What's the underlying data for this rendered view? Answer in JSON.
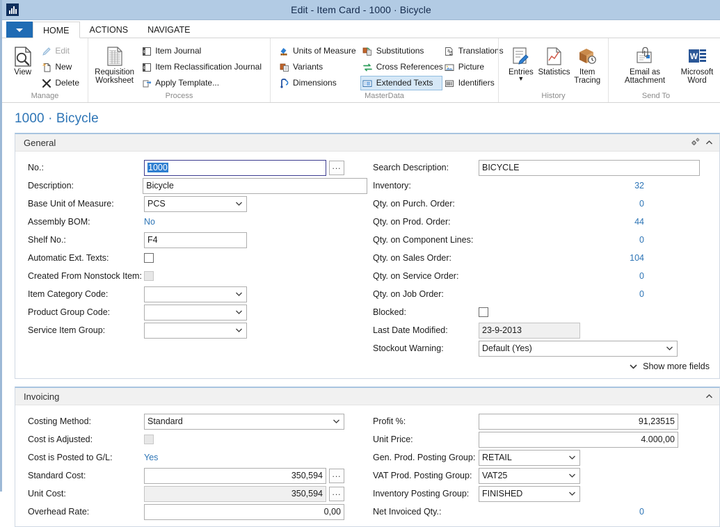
{
  "window": {
    "title": "Edit - Item Card - 1000 · Bicycle",
    "app_icon": "nav-app-icon"
  },
  "ribbon": {
    "app_menu": "application-menu",
    "tabs": [
      {
        "label": "HOME",
        "active": true
      },
      {
        "label": "ACTIONS",
        "active": false
      },
      {
        "label": "NAVIGATE",
        "active": false
      }
    ],
    "groups": [
      {
        "name": "Manage",
        "big": [
          {
            "label": "View",
            "icon": "view-page-icon"
          }
        ],
        "small": [
          {
            "label": "Edit",
            "icon": "pencil-icon",
            "state": "disabled"
          },
          {
            "label": "New",
            "icon": "new-page-icon",
            "state": "normal"
          },
          {
            "label": "Delete",
            "icon": "delete-x-icon",
            "state": "normal"
          }
        ]
      },
      {
        "name": "Process",
        "big": [
          {
            "label": "Requisition Worksheet",
            "icon": "worksheet-icon"
          }
        ],
        "small": [
          {
            "label": "Item Journal",
            "icon": "journal-icon",
            "state": "normal"
          },
          {
            "label": "Item Reclassification Journal",
            "icon": "journal-icon",
            "state": "normal"
          },
          {
            "label": "Apply Template...",
            "icon": "apply-template-icon",
            "state": "normal"
          }
        ]
      },
      {
        "name": "MasterData",
        "columns": [
          [
            {
              "label": "Units of Measure",
              "icon": "units-of-measure-icon",
              "state": "normal"
            },
            {
              "label": "Variants",
              "icon": "variants-icon",
              "state": "normal"
            },
            {
              "label": "Dimensions",
              "icon": "dimensions-icon",
              "state": "normal"
            }
          ],
          [
            {
              "label": "Substitutions",
              "icon": "substitutions-icon",
              "state": "normal"
            },
            {
              "label": "Cross References",
              "icon": "cross-references-icon",
              "state": "normal"
            },
            {
              "label": "Extended Texts",
              "icon": "extended-texts-icon",
              "state": "selected"
            }
          ],
          [
            {
              "label": "Translations",
              "icon": "translations-icon",
              "state": "normal"
            },
            {
              "label": "Picture",
              "icon": "picture-icon",
              "state": "normal"
            },
            {
              "label": "Identifiers",
              "icon": "identifiers-icon",
              "state": "normal"
            }
          ]
        ]
      },
      {
        "name": "History",
        "big": [
          {
            "label": "Entries",
            "icon": "entries-icon",
            "dropdown": true
          },
          {
            "label": "Statistics",
            "icon": "statistics-icon"
          },
          {
            "label": "Item Tracing",
            "icon": "item-tracing-icon"
          }
        ]
      },
      {
        "name": "Send To",
        "big": [
          {
            "label": "Email as Attachment",
            "icon": "email-attachment-icon"
          },
          {
            "label": "Microsoft Word",
            "icon": "microsoft-word-icon"
          }
        ]
      }
    ]
  },
  "page": {
    "heading_no": "1000",
    "heading_sep": "·",
    "heading_name": "Bicycle"
  },
  "general": {
    "title": "General",
    "left": {
      "no_label": "No.:",
      "no_value": "1000",
      "description_label": "Description:",
      "description_value": "Bicycle",
      "base_uom_label": "Base Unit of Measure:",
      "base_uom_value": "PCS",
      "assembly_bom_label": "Assembly BOM:",
      "assembly_bom_value": "No",
      "shelf_no_label": "Shelf No.:",
      "shelf_no_value": "F4",
      "auto_ext_texts_label": "Automatic Ext. Texts:",
      "auto_ext_texts_checked": false,
      "created_nonstock_label": "Created From Nonstock Item:",
      "created_nonstock_checked": false,
      "item_category_label": "Item Category Code:",
      "item_category_value": "",
      "product_group_label": "Product Group Code:",
      "product_group_value": "",
      "service_item_group_label": "Service Item Group:",
      "service_item_group_value": ""
    },
    "right": {
      "search_description_label": "Search Description:",
      "search_description_value": "BICYCLE",
      "inventory_label": "Inventory:",
      "inventory_value": "32",
      "qty_purch_label": "Qty. on Purch. Order:",
      "qty_purch_value": "0",
      "qty_prod_label": "Qty. on Prod. Order:",
      "qty_prod_value": "44",
      "qty_component_label": "Qty. on Component Lines:",
      "qty_component_value": "0",
      "qty_sales_label": "Qty. on Sales Order:",
      "qty_sales_value": "104",
      "qty_service_label": "Qty. on Service Order:",
      "qty_service_value": "0",
      "qty_job_label": "Qty. on Job Order:",
      "qty_job_value": "0",
      "blocked_label": "Blocked:",
      "blocked_checked": false,
      "last_date_modified_label": "Last Date Modified:",
      "last_date_modified_value": "23-9-2013",
      "stockout_warning_label": "Stockout Warning:",
      "stockout_warning_value": "Default (Yes)"
    },
    "show_more_label": "Show more fields"
  },
  "invoicing": {
    "title": "Invoicing",
    "left": {
      "costing_method_label": "Costing Method:",
      "costing_method_value": "Standard",
      "cost_is_adjusted_label": "Cost is Adjusted:",
      "cost_is_adjusted_checked": false,
      "cost_posted_gl_label": "Cost is Posted to G/L:",
      "cost_posted_gl_value": "Yes",
      "standard_cost_label": "Standard Cost:",
      "standard_cost_value": "350,594",
      "unit_cost_label": "Unit Cost:",
      "unit_cost_value": "350,594",
      "overhead_rate_label": "Overhead Rate:",
      "overhead_rate_value": "0,00"
    },
    "right": {
      "profit_pct_label": "Profit %:",
      "profit_pct_value": "91,23515",
      "unit_price_label": "Unit Price:",
      "unit_price_value": "4.000,00",
      "gen_prod_posting_label": "Gen. Prod. Posting Group:",
      "gen_prod_posting_value": "RETAIL",
      "vat_prod_posting_label": "VAT Prod. Posting Group:",
      "vat_prod_posting_value": "VAT25",
      "inventory_posting_label": "Inventory Posting Group:",
      "inventory_posting_value": "FINISHED",
      "net_invoiced_qty_label": "Net Invoiced Qty.:",
      "net_invoiced_qty_value": "0"
    }
  },
  "colors": {
    "titlebar": "#b2cbe4",
    "accent_blue": "#1f6cb4",
    "link_blue": "#2e75b6",
    "selection_blue": "#2f7fd1"
  }
}
